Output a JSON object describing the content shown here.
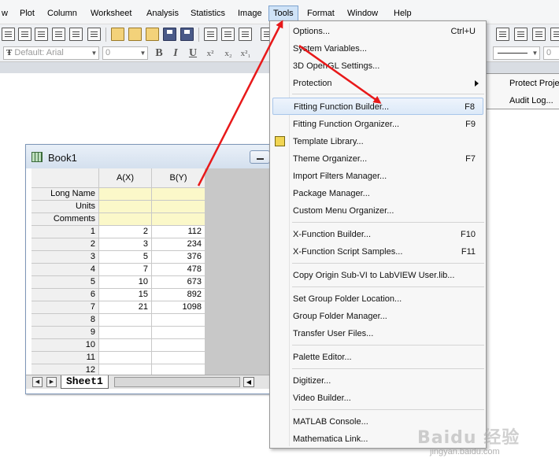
{
  "menubar": {
    "items": [
      "w",
      "Plot",
      "Column",
      "Worksheet",
      "Analysis",
      "Statistics",
      "Image",
      "Tools",
      "Format",
      "Window",
      "Help"
    ]
  },
  "formatbar": {
    "font": "Default: Arial",
    "size": "0",
    "bold": "B",
    "italic": "I",
    "underline": "U",
    "superscript": "x²",
    "subscript": "x₂",
    "supsub": "x²₁",
    "line_width": "0"
  },
  "book": {
    "title": "Book1",
    "columns": [
      "A(X)",
      "B(Y)"
    ],
    "meta_rows": [
      "Long Name",
      "Units",
      "Comments"
    ],
    "rows": [
      {
        "n": "1",
        "a": "2",
        "b": "112"
      },
      {
        "n": "2",
        "a": "3",
        "b": "234"
      },
      {
        "n": "3",
        "a": "5",
        "b": "376"
      },
      {
        "n": "4",
        "a": "7",
        "b": "478"
      },
      {
        "n": "5",
        "a": "10",
        "b": "673"
      },
      {
        "n": "6",
        "a": "15",
        "b": "892"
      },
      {
        "n": "7",
        "a": "21",
        "b": "1098"
      },
      {
        "n": "8",
        "a": "",
        "b": ""
      },
      {
        "n": "9",
        "a": "",
        "b": ""
      },
      {
        "n": "10",
        "a": "",
        "b": ""
      },
      {
        "n": "11",
        "a": "",
        "b": ""
      },
      {
        "n": "12",
        "a": "",
        "b": ""
      }
    ],
    "sheet_tab": "Sheet1"
  },
  "tools_menu": {
    "items": [
      {
        "label": "Options...",
        "shortcut": "Ctrl+U"
      },
      {
        "label": "System Variables...",
        "shortcut": ""
      },
      {
        "label": "3D OpenGL Settings...",
        "shortcut": ""
      },
      {
        "label": "Protection",
        "shortcut": ""
      },
      {
        "label": "Fitting Function Builder...",
        "shortcut": "F8"
      },
      {
        "label": "Fitting Function Organizer...",
        "shortcut": "F9"
      },
      {
        "label": "Template Library...",
        "shortcut": ""
      },
      {
        "label": "Theme Organizer...",
        "shortcut": "F7"
      },
      {
        "label": "Import Filters Manager...",
        "shortcut": ""
      },
      {
        "label": "Package Manager...",
        "shortcut": ""
      },
      {
        "label": "Custom Menu Organizer...",
        "shortcut": ""
      },
      {
        "label": "X-Function Builder...",
        "shortcut": "F10"
      },
      {
        "label": "X-Function Script Samples...",
        "shortcut": "F11"
      },
      {
        "label": "Copy Origin Sub-VI to LabVIEW User.lib...",
        "shortcut": ""
      },
      {
        "label": "Set Group Folder Location...",
        "shortcut": ""
      },
      {
        "label": "Group Folder Manager...",
        "shortcut": ""
      },
      {
        "label": "Transfer User Files...",
        "shortcut": ""
      },
      {
        "label": "Palette Editor...",
        "shortcut": ""
      },
      {
        "label": "Digitizer...",
        "shortcut": ""
      },
      {
        "label": "Video Builder...",
        "shortcut": ""
      },
      {
        "label": "MATLAB Console...",
        "shortcut": ""
      },
      {
        "label": "Mathematica Link...",
        "shortcut": ""
      }
    ]
  },
  "protection_submenu": {
    "items": [
      "Protect Proje",
      "Audit Log..."
    ]
  },
  "watermark": {
    "brand": "Baidu 经验",
    "url": "jingyan.baidu.com"
  },
  "colors": {
    "annotation_arrow": "#e8191a",
    "highlight_border": "#a9c6ea",
    "meta_row_fill": "#fbf8c9"
  }
}
